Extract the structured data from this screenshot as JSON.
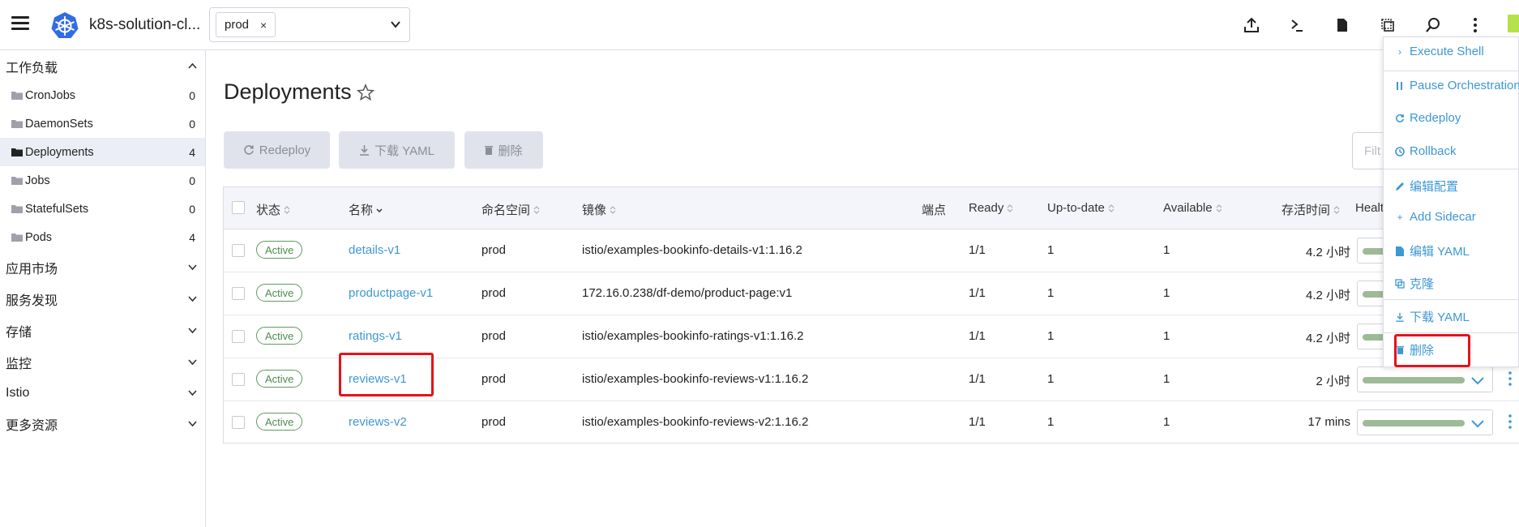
{
  "header": {
    "cluster_name": "k8s-solution-cl...",
    "namespace_tag": "prod",
    "namespace_remove": "×",
    "icons": [
      "upload-icon",
      "terminal-icon",
      "file-icon",
      "copy-icon",
      "search-icon",
      "more-vertical-icon"
    ]
  },
  "sidebar": {
    "workloads": {
      "label": "工作负载",
      "items": [
        {
          "label": "CronJobs",
          "count": "0"
        },
        {
          "label": "DaemonSets",
          "count": "0"
        },
        {
          "label": "Deployments",
          "count": "4"
        },
        {
          "label": "Jobs",
          "count": "0"
        },
        {
          "label": "StatefulSets",
          "count": "0"
        },
        {
          "label": "Pods",
          "count": "4"
        }
      ]
    },
    "groups": [
      "应用市场",
      "服务发现",
      "存储",
      "监控",
      "Istio",
      "更多资源"
    ]
  },
  "page": {
    "title": "Deployments",
    "buttons": {
      "redeploy": "Redeploy",
      "download_yaml": "下载 YAML",
      "delete": "删除"
    },
    "filter_placeholder": "Filt"
  },
  "table": {
    "headers": {
      "state": "状态",
      "name": "名称",
      "namespace": "命名空间",
      "image": "镜像",
      "endpoints": "端点",
      "ready": "Ready",
      "uptodate": "Up-to-date",
      "available": "Available",
      "age": "存活时间",
      "health": "Healt"
    },
    "rows": [
      {
        "state": "Active",
        "name": "details-v1",
        "namespace": "prod",
        "image": "istio/examples-bookinfo-details-v1:1.16.2",
        "ready": "1/1",
        "uptodate": "1",
        "available": "1",
        "age": "4.2 小时"
      },
      {
        "state": "Active",
        "name": "productpage-v1",
        "namespace": "prod",
        "image": "172.16.0.238/df-demo/product-page:v1",
        "ready": "1/1",
        "uptodate": "1",
        "available": "1",
        "age": "4.2 小时"
      },
      {
        "state": "Active",
        "name": "ratings-v1",
        "namespace": "prod",
        "image": "istio/examples-bookinfo-ratings-v1:1.16.2",
        "ready": "1/1",
        "uptodate": "1",
        "available": "1",
        "age": "4.2 小时"
      },
      {
        "state": "Active",
        "name": "reviews-v1",
        "namespace": "prod",
        "image": "istio/examples-bookinfo-reviews-v1:1.16.2",
        "ready": "1/1",
        "uptodate": "1",
        "available": "1",
        "age": "2 小时"
      },
      {
        "state": "Active",
        "name": "reviews-v2",
        "namespace": "prod",
        "image": "istio/examples-bookinfo-reviews-v2:1.16.2",
        "ready": "1/1",
        "uptodate": "1",
        "available": "1",
        "age": "17 mins"
      }
    ]
  },
  "menu": {
    "items": [
      {
        "label": "Execute Shell",
        "icon": "chevron-right-icon"
      },
      {
        "label": "Pause Orchestration",
        "icon": "pause-icon"
      },
      {
        "label": "Redeploy",
        "icon": "refresh-icon"
      },
      {
        "label": "Rollback",
        "icon": "history-icon"
      },
      {
        "label": "编辑配置",
        "icon": "edit-icon"
      },
      {
        "label": "Add Sidecar",
        "icon": "plus-icon"
      },
      {
        "label": "编辑 YAML",
        "icon": "file-icon"
      },
      {
        "label": "克隆",
        "icon": "copy-icon"
      },
      {
        "label": "下载 YAML",
        "icon": "download-icon"
      },
      {
        "label": "删除",
        "icon": "trash-icon"
      }
    ]
  },
  "colors": {
    "link": "#3d98d3",
    "active_badge": "#4d8a4d",
    "highlight": "#e5121b",
    "accent": "#b5e24a"
  }
}
